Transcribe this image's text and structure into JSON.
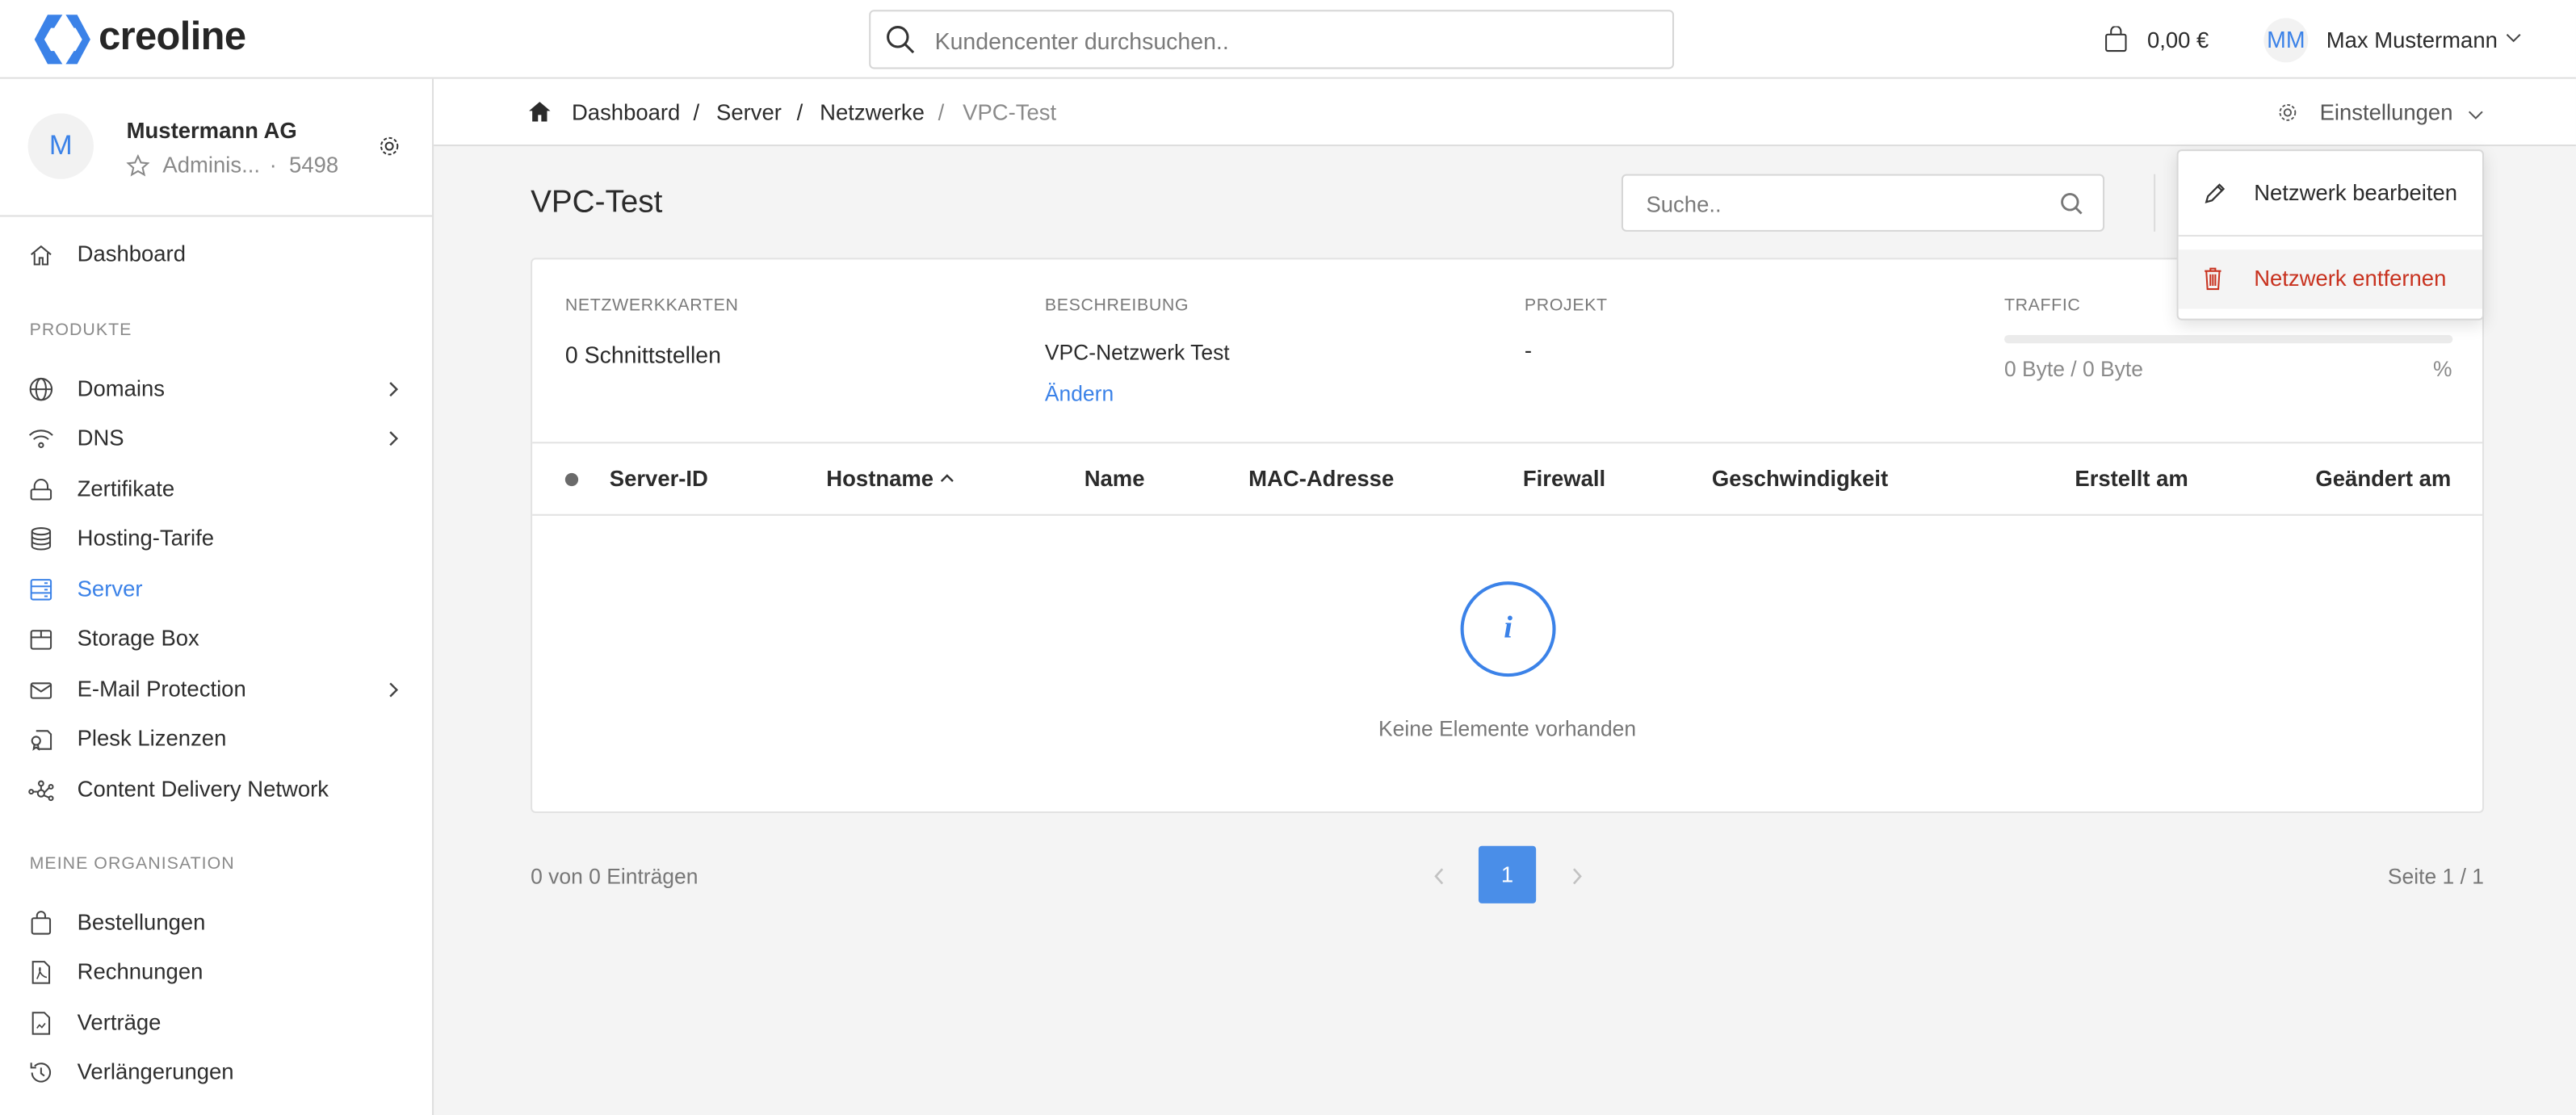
{
  "header": {
    "brand": "creoline",
    "search_placeholder": "Kundencenter durchsuchen..",
    "cart_total": "0,00 €",
    "user_initials": "MM",
    "user_name": "Max Mustermann"
  },
  "org": {
    "initial": "M",
    "name": "Mustermann AG",
    "role": "Adminis...",
    "separator": "·",
    "id": "5498"
  },
  "sidebar": {
    "dashboard": "Dashboard",
    "section_products": "PRODUKTE",
    "products": [
      {
        "label": "Domains",
        "icon": "globe-icon",
        "chevron": true
      },
      {
        "label": "DNS",
        "icon": "wifi-icon",
        "chevron": true
      },
      {
        "label": "Zertifikate",
        "icon": "lock-icon",
        "chevron": false
      },
      {
        "label": "Hosting-Tarife",
        "icon": "database-icon",
        "chevron": false
      },
      {
        "label": "Server",
        "icon": "server-icon",
        "chevron": false,
        "active": true
      },
      {
        "label": "Storage Box",
        "icon": "box-icon",
        "chevron": false
      },
      {
        "label": "E-Mail Protection",
        "icon": "mail-icon",
        "chevron": true
      },
      {
        "label": "Plesk Lizenzen",
        "icon": "certificate-icon",
        "chevron": false
      },
      {
        "label": "Content Delivery Network",
        "icon": "network-icon",
        "chevron": false
      }
    ],
    "section_org": "MEINE ORGANISATION",
    "org_items": [
      {
        "label": "Bestellungen",
        "icon": "bag-icon"
      },
      {
        "label": "Rechnungen",
        "icon": "pdf-icon"
      },
      {
        "label": "Verträge",
        "icon": "document-icon"
      },
      {
        "label": "Verlängerungen",
        "icon": "history-icon"
      }
    ]
  },
  "breadcrumb": {
    "items": [
      "Dashboard",
      "Server",
      "Netzwerke"
    ],
    "current": "VPC-Test",
    "separator": "/",
    "settings": "Einstellungen"
  },
  "page": {
    "title": "VPC-Test",
    "search_placeholder": "Suche.."
  },
  "info": {
    "nics_label": "NETZWERKKARTEN",
    "nics_value": "0 Schnittstellen",
    "desc_label": "BESCHREIBUNG",
    "desc_value": "VPC-Netzwerk Test",
    "desc_edit": "Ändern",
    "project_label": "PROJEKT",
    "project_value": "-",
    "traffic_label": "TRAFFIC",
    "traffic_value": "0 Byte / 0 Byte",
    "traffic_percent": "%",
    "traffic_fill": 0
  },
  "table": {
    "columns": [
      "Server-ID",
      "Hostname",
      "Name",
      "MAC-Adresse",
      "Firewall",
      "Geschwindigkeit",
      "Erstellt am",
      "Geändert am"
    ],
    "sort_indicator": "^",
    "empty": "Keine Elemente vorhanden"
  },
  "footer": {
    "count": "0 von 0 Einträgen",
    "page": "1",
    "page_info": "Seite 1 / 1"
  },
  "dropdown": {
    "edit": "Netzwerk bearbeiten",
    "remove": "Netzwerk entfernen"
  },
  "colors": {
    "accent": "#3b82e8",
    "danger": "#c8321f"
  }
}
